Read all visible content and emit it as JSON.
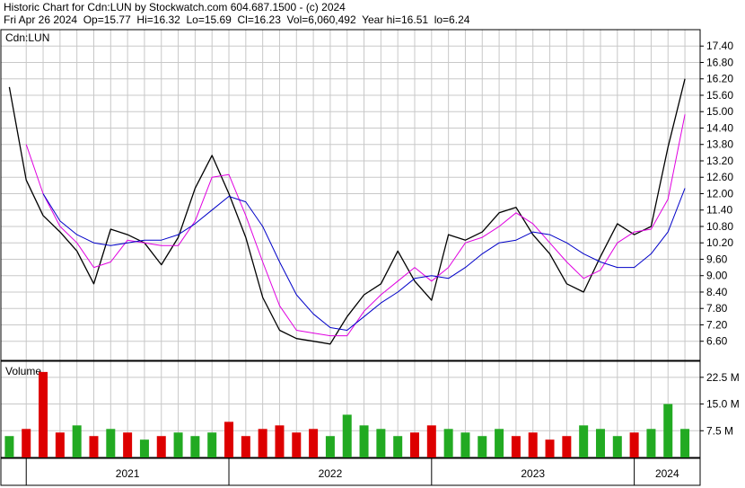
{
  "header": {
    "line1": "Historic Chart for Cdn:LUN by Stockwatch.com 604.687.1500 - (c) 2024",
    "line2": "Fri Apr 26 2024  Op=15.77  Hi=16.32  Lo=15.69  Cl=16.23  Vol=6,060,492  Year hi=16.51  lo=6.24"
  },
  "colors": {
    "price": "#000000",
    "ma_short": "#e000e0",
    "ma_long": "#0000c8",
    "vol_up": "#22aa22",
    "vol_down": "#dd0000",
    "grid": "#c8c8c8",
    "frame": "#000000"
  },
  "chart_data": [
    {
      "type": "line",
      "label": "Cdn:LUN",
      "y_ticks": [
        "17.40",
        "16.80",
        "16.20",
        "15.60",
        "15.00",
        "14.40",
        "13.80",
        "13.20",
        "12.60",
        "12.00",
        "11.40",
        "10.80",
        "10.20",
        "9.60",
        "9.00",
        "8.40",
        "7.80",
        "7.20",
        "6.60"
      ],
      "ylim": [
        5.9,
        18.0
      ],
      "x_labels": [
        "2021",
        "2022",
        "2023",
        "2024"
      ],
      "series": [
        {
          "key": "price",
          "x": [
            "2020-12",
            "2021-01",
            "2021-02",
            "2021-03",
            "2021-04",
            "2021-05",
            "2021-06",
            "2021-07",
            "2021-08",
            "2021-09",
            "2021-10",
            "2021-11",
            "2021-12",
            "2022-01",
            "2022-02",
            "2022-03",
            "2022-04",
            "2022-05",
            "2022-06",
            "2022-07",
            "2022-08",
            "2022-09",
            "2022-10",
            "2022-11",
            "2022-12",
            "2023-01",
            "2023-02",
            "2023-03",
            "2023-04",
            "2023-05",
            "2023-06",
            "2023-07",
            "2023-08",
            "2023-09",
            "2023-10",
            "2023-11",
            "2023-12",
            "2024-01",
            "2024-02",
            "2024-03",
            "2024-04"
          ],
          "values": [
            15.9,
            12.5,
            11.2,
            10.6,
            9.9,
            8.7,
            10.7,
            10.5,
            10.2,
            9.4,
            10.4,
            12.2,
            13.4,
            12.0,
            10.4,
            8.2,
            7.0,
            6.7,
            6.6,
            6.5,
            7.5,
            8.3,
            8.7,
            9.9,
            8.8,
            8.1,
            10.5,
            10.3,
            10.6,
            11.3,
            11.5,
            10.5,
            9.8,
            8.7,
            8.4,
            9.7,
            10.9,
            10.5,
            10.8,
            13.7,
            16.2
          ]
        },
        {
          "key": "ma_short",
          "x": [
            "2021-01",
            "2021-02",
            "2021-03",
            "2021-04",
            "2021-05",
            "2021-06",
            "2021-07",
            "2021-08",
            "2021-09",
            "2021-10",
            "2021-11",
            "2021-12",
            "2022-01",
            "2022-02",
            "2022-03",
            "2022-04",
            "2022-05",
            "2022-06",
            "2022-07",
            "2022-08",
            "2022-09",
            "2022-10",
            "2022-11",
            "2022-12",
            "2023-01",
            "2023-02",
            "2023-03",
            "2023-04",
            "2023-05",
            "2023-06",
            "2023-07",
            "2023-08",
            "2023-09",
            "2023-10",
            "2023-11",
            "2023-12",
            "2024-01",
            "2024-02",
            "2024-03",
            "2024-04"
          ],
          "values": [
            13.8,
            12.0,
            10.8,
            10.2,
            9.3,
            9.5,
            10.3,
            10.2,
            10.1,
            10.1,
            11.0,
            12.6,
            12.7,
            11.2,
            9.5,
            7.9,
            7.0,
            6.9,
            6.8,
            6.8,
            7.7,
            8.3,
            8.8,
            9.3,
            8.8,
            9.3,
            10.2,
            10.4,
            10.8,
            11.3,
            10.9,
            10.2,
            9.5,
            8.9,
            9.2,
            10.2,
            10.6,
            10.7,
            11.8,
            14.9
          ]
        },
        {
          "key": "ma_long",
          "x": [
            "2021-02",
            "2021-03",
            "2021-04",
            "2021-05",
            "2021-06",
            "2021-07",
            "2021-08",
            "2021-09",
            "2021-10",
            "2021-11",
            "2021-12",
            "2022-01",
            "2022-02",
            "2022-03",
            "2022-04",
            "2022-05",
            "2022-06",
            "2022-07",
            "2022-08",
            "2022-09",
            "2022-10",
            "2022-11",
            "2022-12",
            "2023-01",
            "2023-02",
            "2023-03",
            "2023-04",
            "2023-05",
            "2023-06",
            "2023-07",
            "2023-08",
            "2023-09",
            "2023-10",
            "2023-11",
            "2023-12",
            "2024-01",
            "2024-02",
            "2024-03",
            "2024-04"
          ],
          "values": [
            12.0,
            11.0,
            10.5,
            10.2,
            10.1,
            10.2,
            10.3,
            10.3,
            10.5,
            10.9,
            11.4,
            11.9,
            11.7,
            10.8,
            9.5,
            8.3,
            7.6,
            7.1,
            7.0,
            7.5,
            8.0,
            8.4,
            8.9,
            9.0,
            8.9,
            9.3,
            9.8,
            10.2,
            10.3,
            10.6,
            10.5,
            10.2,
            9.8,
            9.5,
            9.3,
            9.3,
            9.8,
            10.6,
            12.2
          ]
        }
      ]
    },
    {
      "type": "bar",
      "label": "Volume",
      "y_ticks": [
        "22.5 M",
        "15.0 M",
        "7.5 M"
      ],
      "ylim": [
        0,
        27
      ],
      "x": [
        "2020-12",
        "2021-01",
        "2021-02",
        "2021-03",
        "2021-04",
        "2021-05",
        "2021-06",
        "2021-07",
        "2021-08",
        "2021-09",
        "2021-10",
        "2021-11",
        "2021-12",
        "2022-01",
        "2022-02",
        "2022-03",
        "2022-04",
        "2022-05",
        "2022-06",
        "2022-07",
        "2022-08",
        "2022-09",
        "2022-10",
        "2022-11",
        "2022-12",
        "2023-01",
        "2023-02",
        "2023-03",
        "2023-04",
        "2023-05",
        "2023-06",
        "2023-07",
        "2023-08",
        "2023-09",
        "2023-10",
        "2023-11",
        "2023-12",
        "2024-01",
        "2024-02",
        "2024-03",
        "2024-04"
      ],
      "values": [
        6,
        8,
        24,
        7,
        9,
        6,
        8,
        7,
        5,
        6,
        7,
        6,
        7,
        10,
        6,
        8,
        9,
        7,
        8,
        6,
        12,
        9,
        8,
        6,
        7,
        9,
        8,
        7,
        6,
        8,
        6,
        7,
        5,
        6,
        9,
        8,
        6,
        7,
        8,
        15,
        8
      ],
      "up": [
        true,
        false,
        false,
        false,
        true,
        false,
        true,
        false,
        true,
        false,
        true,
        true,
        true,
        false,
        false,
        false,
        false,
        false,
        false,
        true,
        true,
        true,
        true,
        true,
        false,
        false,
        true,
        true,
        true,
        true,
        false,
        false,
        false,
        false,
        true,
        true,
        true,
        false,
        true,
        true,
        true
      ]
    }
  ]
}
